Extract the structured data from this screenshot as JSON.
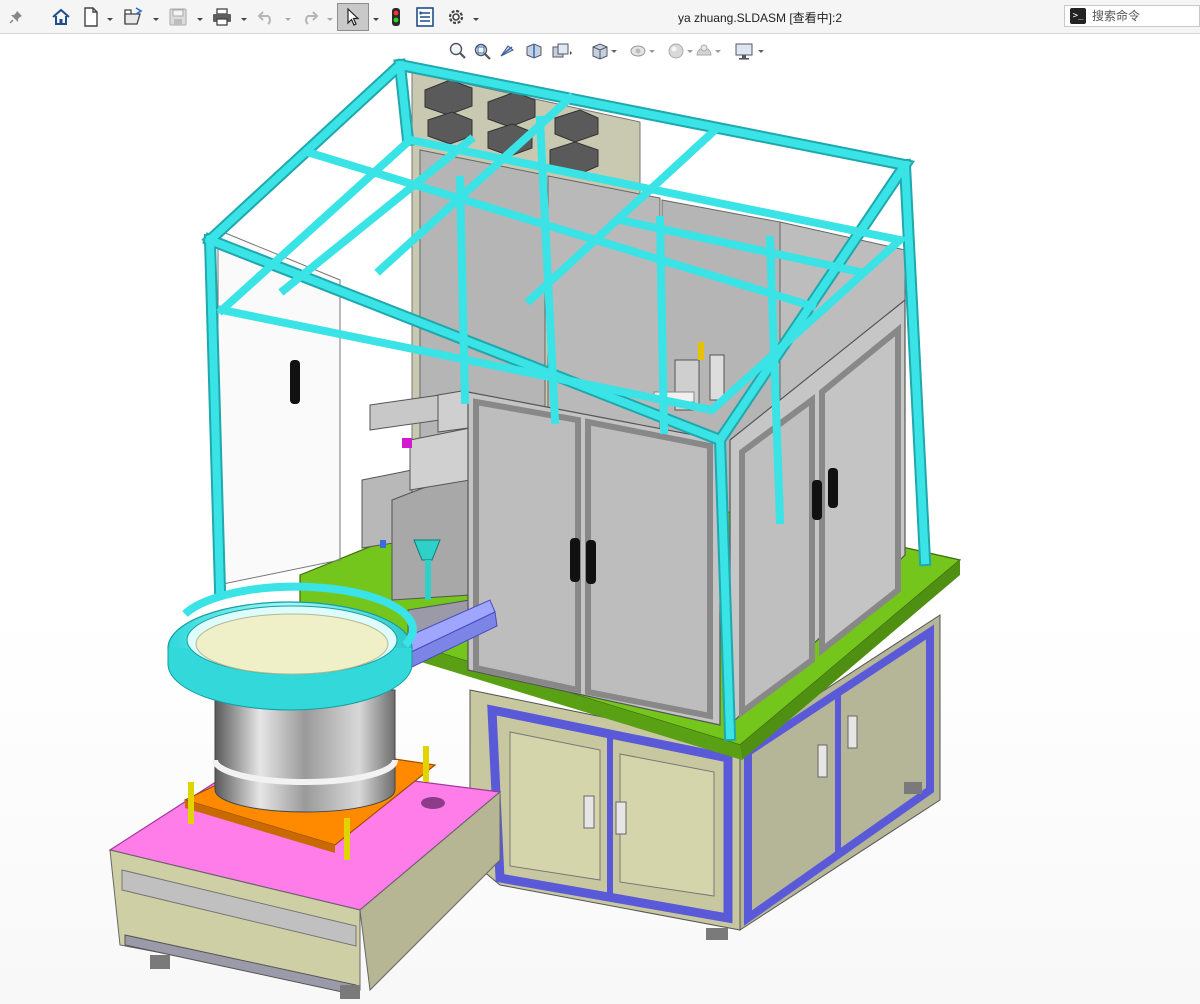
{
  "window": {
    "title": "ya zhuang.SLDASM [查看中]:2"
  },
  "toolbar": {
    "items": [
      {
        "name": "pin",
        "icon": "pin-icon"
      },
      {
        "name": "home",
        "icon": "home-icon"
      },
      {
        "name": "new",
        "icon": "new-document-icon"
      },
      {
        "name": "open",
        "icon": "open-folder-icon"
      },
      {
        "name": "save",
        "icon": "save-icon"
      },
      {
        "name": "print",
        "icon": "print-icon"
      },
      {
        "name": "undo",
        "icon": "undo-icon"
      },
      {
        "name": "redo",
        "icon": "redo-icon"
      },
      {
        "name": "select",
        "icon": "select-arrow-icon"
      },
      {
        "name": "rebuild",
        "icon": "traffic-light-icon"
      },
      {
        "name": "file-properties",
        "icon": "file-properties-icon"
      },
      {
        "name": "options",
        "icon": "gear-icon"
      }
    ]
  },
  "search": {
    "placeholder": "搜索命令",
    "icon": "command-prompt-icon"
  },
  "view_toolbar": {
    "items": [
      {
        "icon": "zoom-to-fit-icon"
      },
      {
        "icon": "zoom-to-area-icon"
      },
      {
        "icon": "previous-view-icon"
      },
      {
        "icon": "section-view-icon"
      },
      {
        "icon": "dynamic-annotation-icon"
      },
      {
        "icon": "view-orientation-icon"
      },
      {
        "icon": "display-style-icon"
      },
      {
        "icon": "hide-show-items-icon"
      },
      {
        "icon": "edit-appearance-icon"
      },
      {
        "icon": "apply-scene-icon"
      },
      {
        "icon": "view-settings-icon"
      }
    ]
  },
  "colors": {
    "frame": "#39e3e6",
    "frame_dark": "#1fa8ad",
    "panel": "#b9b9b9",
    "base_plate": "#6fc21a",
    "feeder_stand": "#ff7fe9",
    "mount_plate": "#ff8a00",
    "cabinet": "#cfcfa6",
    "cabinet_frame": "#6a6adb",
    "bowl": "#41e8ea"
  }
}
